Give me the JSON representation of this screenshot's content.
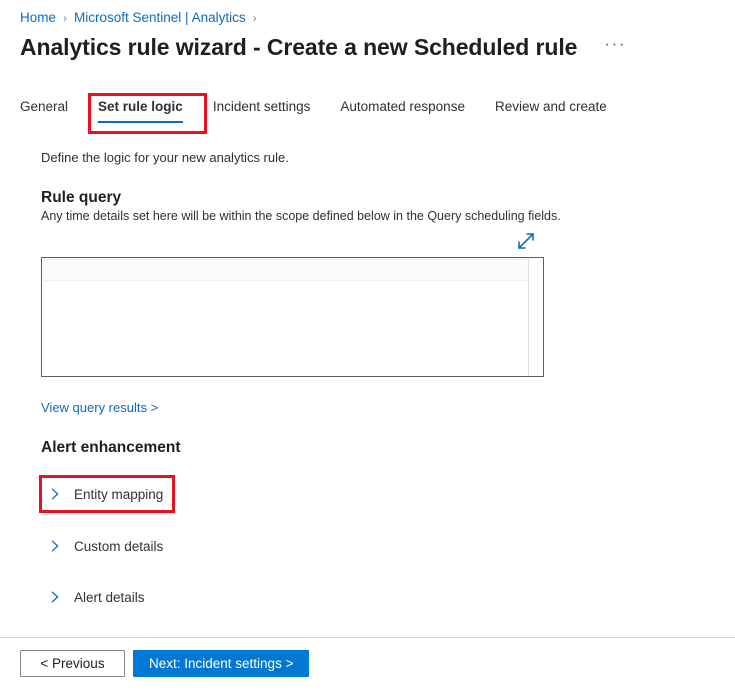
{
  "breadcrumb": {
    "items": [
      {
        "label": "Home"
      },
      {
        "label": "Microsoft Sentinel | Analytics"
      }
    ],
    "separator": "›"
  },
  "header": {
    "title": "Analytics rule wizard - Create a new Scheduled rule",
    "more_label": "···",
    "more_icon": "ellipsis-icon"
  },
  "tabs": [
    {
      "label": "General",
      "active": false
    },
    {
      "label": "Set rule logic",
      "active": true
    },
    {
      "label": "Incident settings",
      "active": false
    },
    {
      "label": "Automated response",
      "active": false
    },
    {
      "label": "Review and create",
      "active": false
    }
  ],
  "main": {
    "intro": "Define the logic for your new analytics rule.",
    "rule_query": {
      "heading": "Rule query",
      "subtext": "Any time details set here will be within the scope defined below in the Query scheduling fields.",
      "expand_icon": "expand-diagonal-icon",
      "editor_value": "",
      "view_results_link": "View query results >"
    },
    "alert_enhancement": {
      "heading": "Alert enhancement",
      "sections": [
        {
          "label": "Entity mapping",
          "icon": "chevron-right-icon",
          "expanded": false,
          "highlighted": true
        },
        {
          "label": "Custom details",
          "icon": "chevron-right-icon",
          "expanded": false,
          "highlighted": false
        },
        {
          "label": "Alert details",
          "icon": "chevron-right-icon",
          "expanded": false,
          "highlighted": false
        }
      ]
    }
  },
  "footer": {
    "previous_label": "< Previous",
    "next_label": "Next: Incident settings >"
  },
  "colors": {
    "accent": "#0078d4",
    "link": "#0f6cbd",
    "annotation": "#e81123",
    "text": "#323130"
  }
}
